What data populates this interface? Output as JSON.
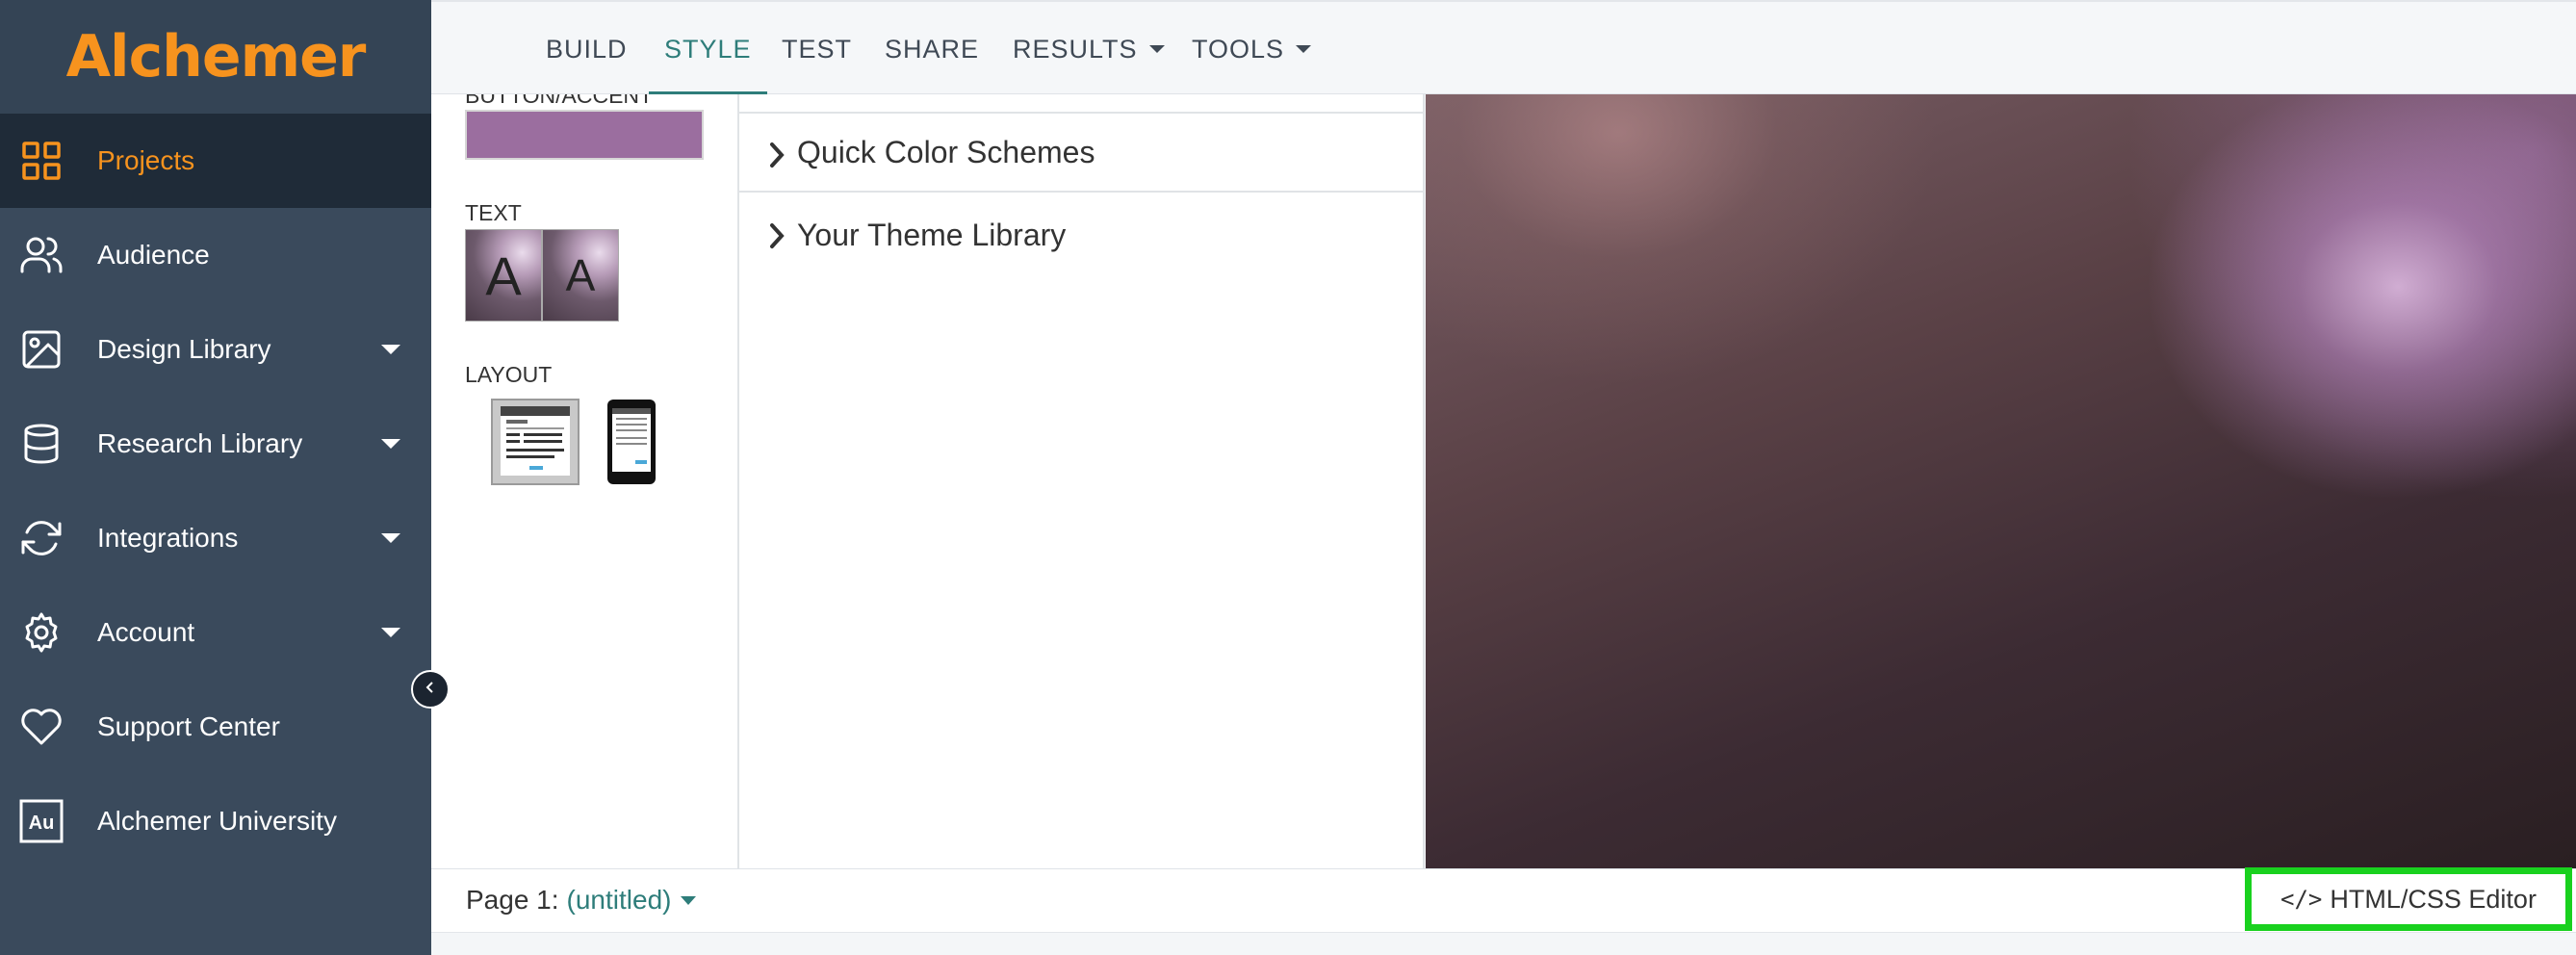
{
  "app": {
    "logo_text": "Alchemer",
    "brand_color": "#f7931e",
    "accent_color": "#2e7d7a"
  },
  "sidebar": {
    "items": [
      {
        "label": "Projects",
        "icon": "grid-icon",
        "active": true,
        "dropdown": false
      },
      {
        "label": "Audience",
        "icon": "users-icon",
        "active": false,
        "dropdown": false
      },
      {
        "label": "Design Library",
        "icon": "image-icon",
        "active": false,
        "dropdown": true
      },
      {
        "label": "Research Library",
        "icon": "database-icon",
        "active": false,
        "dropdown": true
      },
      {
        "label": "Integrations",
        "icon": "refresh-icon",
        "active": false,
        "dropdown": true
      },
      {
        "label": "Account",
        "icon": "gear-icon",
        "active": false,
        "dropdown": true
      },
      {
        "label": "Support Center",
        "icon": "heart-icon",
        "active": false,
        "dropdown": false
      },
      {
        "label": "Alchemer University",
        "icon": "au-icon",
        "active": false,
        "dropdown": false
      }
    ]
  },
  "topnav": {
    "tabs": [
      {
        "label": "BUILD",
        "active": false,
        "dropdown": false
      },
      {
        "label": "STYLE",
        "active": true,
        "dropdown": false
      },
      {
        "label": "TEST",
        "active": false,
        "dropdown": false
      },
      {
        "label": "SHARE",
        "active": false,
        "dropdown": false
      },
      {
        "label": "RESULTS",
        "active": false,
        "dropdown": true
      },
      {
        "label": "TOOLS",
        "active": false,
        "dropdown": true
      }
    ]
  },
  "style_panel": {
    "button_accent_label": "BUTTON/ACCENT",
    "button_accent_color": "#9b6e9f",
    "text_label": "TEXT",
    "text_sample": "A",
    "layout_label": "LAYOUT"
  },
  "middle_panel": {
    "sections": [
      {
        "label": "Quick Color Schemes"
      },
      {
        "label": "Your Theme Library"
      }
    ]
  },
  "footer": {
    "page_prefix": "Page 1:",
    "page_name": "(untitled)",
    "editor_button": "HTML/CSS Editor"
  }
}
